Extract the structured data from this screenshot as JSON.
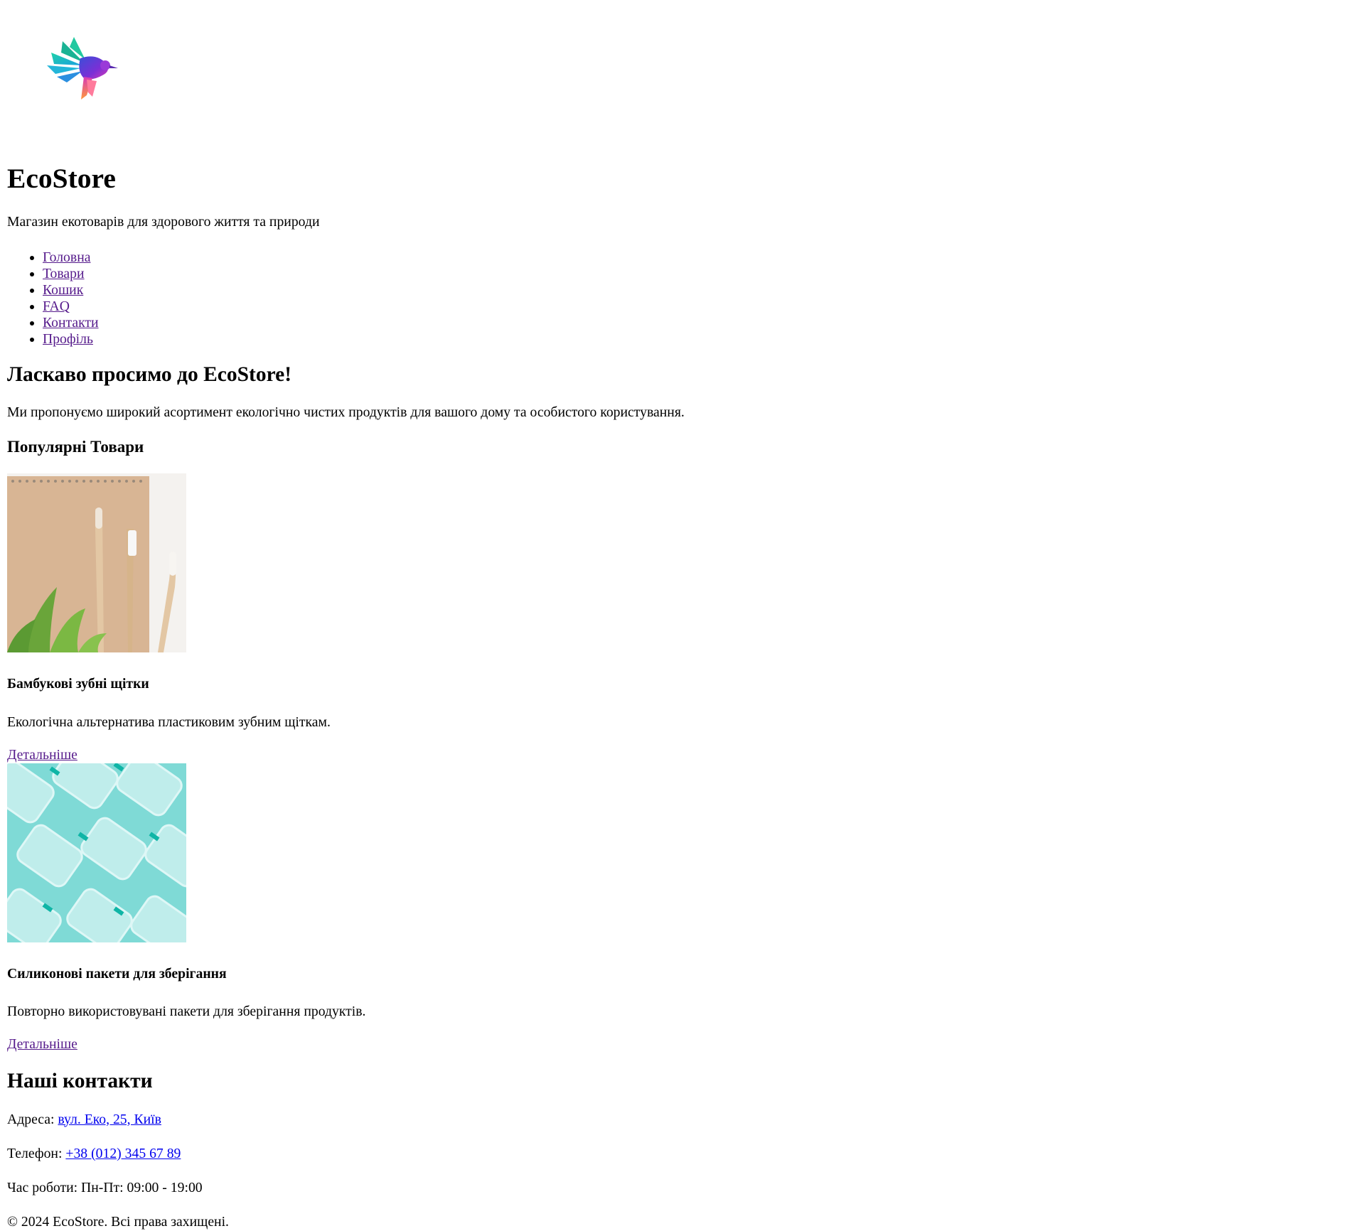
{
  "header": {
    "logo": {
      "icon": "hummingbird-logo-icon",
      "colors": [
        "#1fd1a8",
        "#1a9fe0",
        "#7b2fd6",
        "#d63bb7",
        "#ff9a3c"
      ]
    },
    "title": "EcoStore",
    "tagline": "Магазин екотоварів для здорового життя та природи"
  },
  "nav": {
    "items": [
      {
        "label": "Головна"
      },
      {
        "label": "Товари"
      },
      {
        "label": "Кошик"
      },
      {
        "label": "FAQ"
      },
      {
        "label": "Контакти"
      },
      {
        "label": "Профіль"
      }
    ]
  },
  "main": {
    "welcome_title": "Ласкаво просимо до EcoStore!",
    "welcome_text": "Ми пропонуємо широкий асортимент екологічно чистих продуктів для вашого дому та особистого користування.",
    "popular_title": "Популярні Товари",
    "products": [
      {
        "name": "Бамбукові зубні щітки",
        "description": "Екологічна альтернатива пластиковим зубним щіткам.",
        "link": "Детальніше",
        "image_icon": "bamboo-toothbrushes-image"
      },
      {
        "name": "Силиконові пакети для зберігання",
        "description": "Повторно використовувані пакети для зберігання продуктів.",
        "link": "Детальніше",
        "image_icon": "silicone-containers-image"
      }
    ]
  },
  "contacts": {
    "title": "Наші контакти",
    "address_label": "Адреса: ",
    "address_value": "вул. Еко, 25, Київ",
    "phone_label": "Телефон: ",
    "phone_value": "+38 (012) 345 67 89",
    "hours": "Час роботи: Пн-Пт: 09:00 - 19:00"
  },
  "footer": {
    "copyright": "© 2024 EcoStore. Всі права захищені."
  },
  "colors": {
    "link_visited": "#551a8b",
    "link": "#0000ee"
  }
}
